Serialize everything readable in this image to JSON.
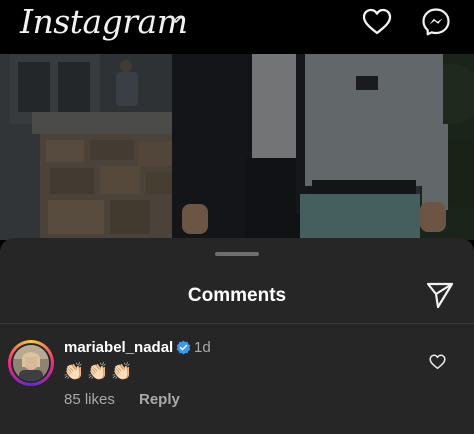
{
  "app": {
    "logo_text": "Instagram"
  },
  "comments_sheet": {
    "title": "Comments"
  },
  "comment": {
    "username": "mariabel_nadal",
    "verified": true,
    "time": "1d",
    "text": "👏🏻👏🏻👏🏻",
    "likes": "85 likes",
    "reply_label": "Reply"
  },
  "icons": {
    "logo_dropdown": "chevron-down-icon",
    "activity": "heart-icon",
    "messages": "messenger-icon",
    "share": "send-icon",
    "verified": "verified-badge-icon",
    "like_comment": "heart-outline-icon"
  },
  "colors": {
    "background": "#000000",
    "sheet": "#262626",
    "secondary_text": "#a8a8a8",
    "verified_blue": "#3897f0"
  }
}
